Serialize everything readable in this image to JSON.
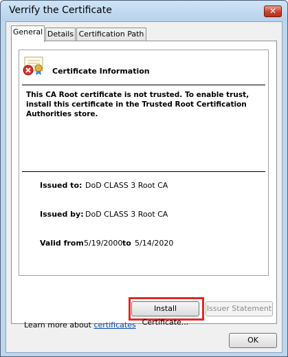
{
  "window": {
    "title": "Verrify the Certificate",
    "close_label": "✕"
  },
  "tabs": [
    {
      "label": "General",
      "active": true
    },
    {
      "label": "Details",
      "active": false
    },
    {
      "label": "Certification Path",
      "active": false
    }
  ],
  "info": {
    "header": "Certificate Information",
    "warning": "This CA Root certificate is not trusted. To enable trust, install this certificate in the Trusted Root Certification Authorities store.",
    "issued_to_label": "Issued to:",
    "issued_to_value": "DoD CLASS 3 Root CA",
    "issued_by_label": "Issued by:",
    "issued_by_value": "DoD CLASS 3 Root CA",
    "valid_from_label": "Valid from",
    "valid_from_value": "5/19/2000",
    "valid_to_label": "to",
    "valid_to_value": "5/14/2020"
  },
  "buttons": {
    "install": "Install Certificate...",
    "issuer_statement": "Issuer Statement",
    "ok": "OK"
  },
  "learn_more": {
    "prefix": "Learn more about ",
    "link": "certificates"
  },
  "colors": {
    "highlight": "#e02828",
    "link": "#0645ad"
  },
  "icons": {
    "certificate": "certificate-error-icon"
  }
}
